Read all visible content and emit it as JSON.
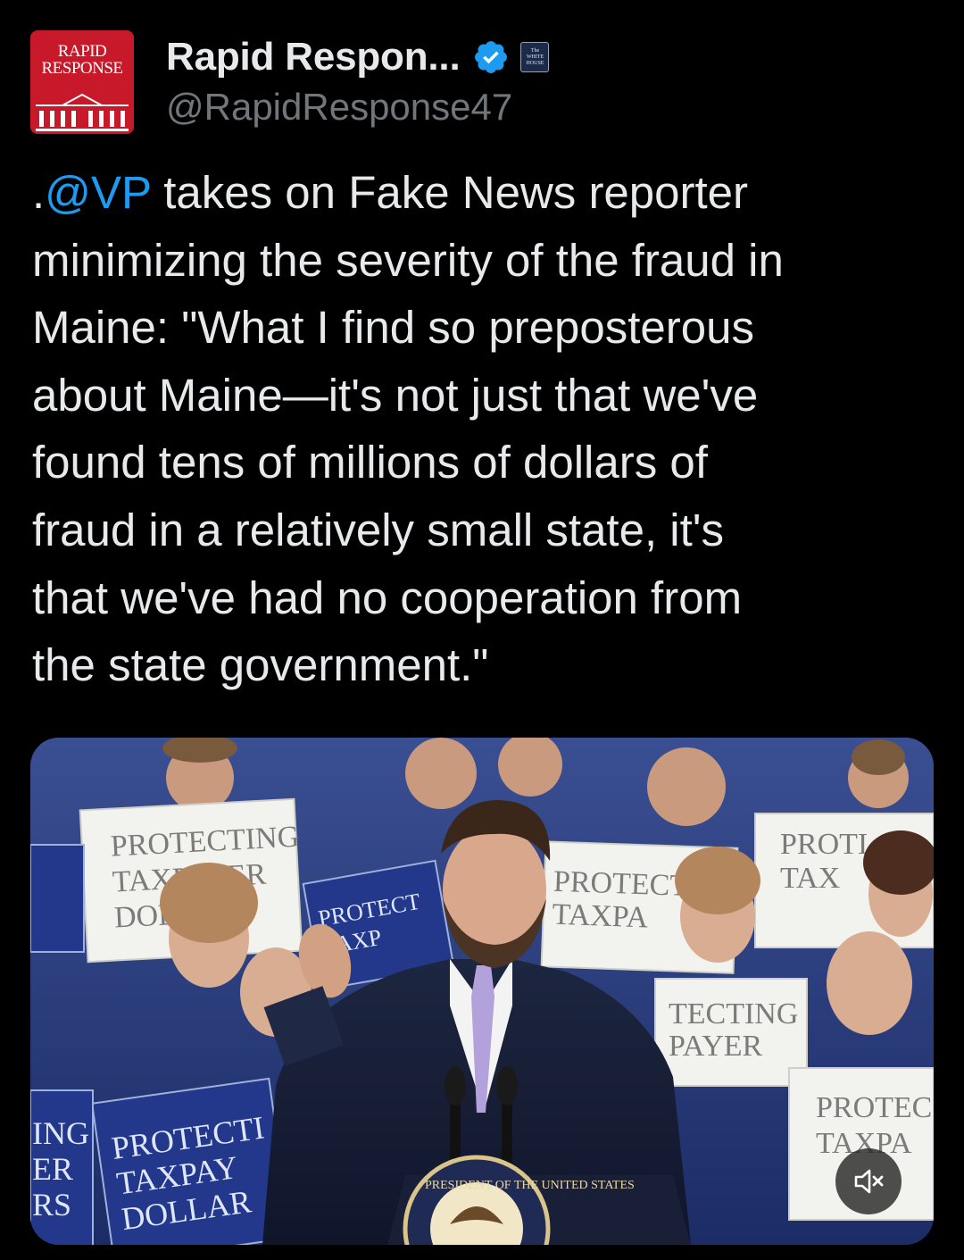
{
  "account": {
    "display_name": "Rapid Respon...",
    "handle": "@RapidResponse47",
    "avatar_text": "RAPID RESPONSE",
    "affiliation_badge_text": "The WHITE HOUSE",
    "verified_color": "#1d9bf0",
    "avatar_color": "#c8192b"
  },
  "tweet": {
    "prefix": ".",
    "mention": "@VP",
    "body": " takes on Fake News reporter\nminimizing the severity of the fraud in\nMaine: \"What I find so preposterous\nabout Maine—it's not just that we've\nfound tens of millions of dollars of\nfraud in a relatively small state, it's\nthat we've had no cooperation from\nthe state government.\"",
    "mention_color": "#1d9bf0"
  },
  "media": {
    "type": "video",
    "sign_text": "PROTECTING TAXPAYER DOLLARS",
    "seal_text": "PRESIDENT OF THE UNITED STATES",
    "mute_icon": "speaker-muted-icon"
  }
}
